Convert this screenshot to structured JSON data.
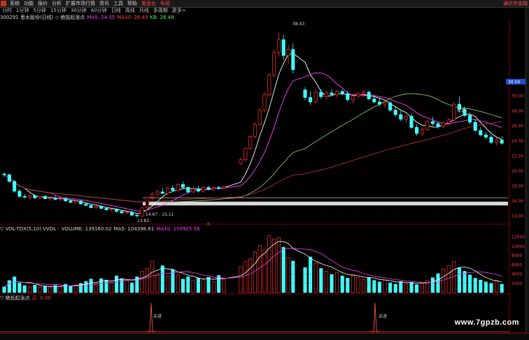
{
  "menu": {
    "items": [
      "系统",
      "功能",
      "报价",
      "分析",
      "扩展市场行情",
      "资讯",
      "工具",
      "帮助",
      "看盘台",
      "布局"
    ],
    "brand": "通达信金融"
  },
  "periods": [
    "分时",
    "1分钟",
    "5分钟",
    "15分钟",
    "30分钟",
    "60分钟",
    "日线",
    "周线",
    "月线",
    "多周期",
    "更多>"
  ],
  "info": {
    "title": "300291 思水股份(日线) ◇ 绝抵起涨点",
    "ma5": "MA5: 24.35",
    "ma30": "MA30: 26.49",
    "k": "KB: 26.48"
  },
  "vol_info": {
    "title": "▽ VOL-TDX(5,10)  VVOL -",
    "volume": "VOLUME: 139160.02",
    "ma5": "MA5: 104398.61",
    "ma10": "MA10: 150925.58"
  },
  "ind_info": {
    "title": "▽ 绝抵起涨点",
    "value": "买: 0.00"
  },
  "price_labels": {
    "high": "38.43",
    "low_a": "13.81",
    "range_a": "14.67 - 15.11",
    "band": "15.16 - 16.15",
    "buy1": "买进",
    "buy2": "买进",
    "buy3": "买进",
    "current": "30.50"
  },
  "y_ticks_price": [
    "30.00",
    "28.00",
    "26.00",
    "24.00",
    "22.00",
    "20.00",
    "18.00",
    "16.00",
    "14.00"
  ],
  "y_ticks_vol": [
    "12000",
    "10000",
    "8000",
    "6000",
    "4000",
    "2000"
  ],
  "x_labels": [
    "2017年",
    "3",
    "4",
    "2017/04/09四",
    "6",
    "7",
    "8",
    "9",
    "10",
    "11"
  ],
  "marker_bottom": "6",
  "watermark": "www.7gpzb.com",
  "colors": {
    "up": "#ff3030",
    "down": "#40ffff",
    "ma5": "#ffffff",
    "ma10": "#ff40ff",
    "ma30": "#80c060",
    "ma60": "#b03030",
    "grid": "#5a0000"
  },
  "chart_data": {
    "type": "candlestick",
    "title": "",
    "ylim": [
      13,
      40
    ],
    "candles": [
      [
        19.6,
        19.8,
        19.2,
        19.5
      ],
      [
        19.5,
        19.6,
        18.4,
        18.6
      ],
      [
        18.6,
        18.8,
        17.1,
        17.3
      ],
      [
        17.3,
        17.6,
        16.4,
        16.6
      ],
      [
        16.6,
        16.9,
        16.3,
        16.5
      ],
      [
        16.5,
        16.8,
        16.2,
        16.7
      ],
      [
        16.7,
        16.9,
        16.3,
        16.4
      ],
      [
        16.4,
        16.7,
        16.2,
        16.6
      ],
      [
        16.6,
        16.8,
        16.2,
        16.3
      ],
      [
        16.3,
        16.6,
        16.0,
        16.4
      ],
      [
        16.4,
        16.7,
        16.1,
        16.2
      ],
      [
        16.2,
        16.5,
        16.0,
        16.3
      ],
      [
        16.3,
        16.5,
        15.9,
        16.0
      ],
      [
        16.0,
        16.2,
        15.7,
        15.8
      ],
      [
        15.8,
        16.1,
        15.6,
        16.0
      ],
      [
        16.0,
        16.1,
        15.5,
        15.6
      ],
      [
        15.6,
        15.8,
        15.3,
        15.4
      ],
      [
        15.4,
        15.6,
        15.0,
        15.1
      ],
      [
        15.1,
        15.4,
        14.9,
        15.3
      ],
      [
        15.3,
        15.5,
        14.9,
        15.0
      ],
      [
        15.0,
        15.2,
        14.7,
        14.8
      ],
      [
        14.8,
        15.0,
        14.6,
        14.9
      ],
      [
        14.9,
        15.0,
        14.5,
        14.6
      ],
      [
        14.6,
        14.8,
        14.3,
        14.4
      ],
      [
        14.4,
        14.6,
        14.2,
        14.5
      ],
      [
        14.5,
        14.7,
        14.0,
        14.1
      ],
      [
        14.1,
        14.3,
        13.8,
        14.0
      ],
      [
        14.0,
        15.2,
        13.9,
        15.1
      ],
      [
        15.1,
        16.6,
        15.0,
        16.5
      ],
      [
        16.5,
        17.2,
        16.1,
        16.9
      ],
      [
        16.9,
        17.5,
        16.6,
        17.2
      ],
      [
        17.2,
        17.7,
        16.9,
        17.0
      ],
      [
        17.0,
        17.9,
        16.8,
        17.7
      ],
      [
        17.7,
        18.1,
        17.2,
        17.4
      ],
      [
        17.4,
        18.4,
        17.3,
        18.2
      ],
      [
        18.2,
        18.6,
        17.6,
        17.8
      ],
      [
        17.8,
        18.0,
        17.0,
        17.2
      ],
      [
        17.2,
        17.8,
        17.0,
        17.6
      ],
      [
        17.6,
        18.0,
        17.1,
        17.3
      ],
      [
        17.3,
        17.9,
        17.1,
        17.8
      ],
      [
        17.8,
        18.0,
        17.4,
        17.6
      ],
      [
        17.6,
        17.9,
        17.3,
        17.8
      ],
      [
        17.8,
        18.0,
        17.5,
        17.7
      ],
      [
        17.7,
        18.0,
        17.5,
        17.9
      ],
      [
        21.0,
        21.8,
        20.8,
        21.5
      ],
      [
        21.5,
        23.1,
        21.3,
        23.0
      ],
      [
        23.0,
        24.8,
        22.8,
        24.6
      ],
      [
        24.6,
        26.5,
        24.3,
        26.2
      ],
      [
        26.2,
        28.4,
        26.0,
        28.1
      ],
      [
        28.1,
        30.5,
        27.8,
        30.2
      ],
      [
        30.2,
        33.0,
        29.9,
        32.8
      ],
      [
        32.8,
        36.2,
        32.5,
        35.8
      ],
      [
        35.8,
        38.43,
        35.2,
        37.5
      ],
      [
        37.5,
        38.2,
        34.8,
        35.4
      ],
      [
        35.4,
        36.8,
        34.2,
        36.2
      ],
      [
        36.2,
        37.0,
        33.0,
        33.5
      ],
      [
        30.8,
        31.2,
        29.4,
        29.8
      ],
      [
        29.8,
        30.6,
        28.8,
        29.2
      ],
      [
        29.2,
        30.8,
        29.0,
        30.5
      ],
      [
        30.5,
        30.9,
        29.6,
        29.9
      ],
      [
        29.9,
        30.7,
        29.5,
        30.4
      ],
      [
        30.4,
        30.9,
        30.0,
        30.2
      ],
      [
        30.2,
        30.8,
        29.8,
        30.6
      ],
      [
        30.6,
        30.9,
        30.1,
        30.3
      ],
      [
        30.3,
        30.7,
        29.2,
        29.5
      ],
      [
        29.5,
        30.2,
        29.0,
        30.0
      ],
      [
        30.0,
        30.6,
        29.7,
        30.3
      ],
      [
        30.3,
        30.8,
        29.9,
        30.5
      ],
      [
        30.5,
        30.7,
        29.4,
        29.6
      ],
      [
        29.6,
        30.1,
        29.0,
        29.2
      ],
      [
        29.2,
        29.7,
        28.6,
        28.9
      ],
      [
        28.9,
        29.4,
        28.4,
        29.1
      ],
      [
        29.1,
        29.3,
        27.9,
        28.1
      ],
      [
        28.1,
        28.5,
        27.2,
        27.5
      ],
      [
        27.5,
        28.0,
        26.6,
        26.9
      ],
      [
        26.9,
        27.5,
        26.4,
        27.3
      ],
      [
        27.3,
        27.6,
        25.6,
        25.8
      ],
      [
        25.8,
        26.2,
        24.7,
        25.0
      ],
      [
        25.0,
        25.8,
        24.6,
        25.5
      ],
      [
        25.5,
        26.8,
        25.3,
        26.6
      ],
      [
        26.6,
        27.2,
        26.0,
        26.3
      ],
      [
        26.3,
        26.6,
        25.6,
        25.9
      ],
      [
        25.9,
        26.6,
        25.7,
        26.4
      ],
      [
        26.4,
        27.0,
        26.1,
        26.8
      ],
      [
        26.8,
        29.2,
        26.6,
        28.9
      ],
      [
        28.9,
        29.9,
        27.8,
        28.2
      ],
      [
        28.2,
        28.6,
        27.2,
        27.4
      ],
      [
        27.4,
        27.8,
        26.2,
        26.5
      ],
      [
        26.5,
        26.9,
        25.2,
        25.4
      ],
      [
        25.4,
        25.8,
        24.6,
        24.8
      ],
      [
        24.8,
        25.2,
        24.2,
        24.5
      ],
      [
        24.5,
        24.8,
        23.6,
        23.8
      ],
      [
        23.8,
        24.4,
        23.4,
        24.1
      ],
      [
        24.1,
        24.6,
        23.5,
        23.7
      ]
    ],
    "volumes": [
      1200,
      2600,
      3400,
      2100,
      1500,
      1300,
      1600,
      1100,
      1400,
      1200,
      1500,
      1300,
      1800,
      1400,
      1600,
      2000,
      2400,
      2900,
      1900,
      3000,
      2700,
      2300,
      3600,
      3000,
      2600,
      2100,
      3400,
      4600,
      5200,
      6800,
      4100,
      5800,
      3600,
      4900,
      3800,
      2900,
      3400,
      2600,
      3100,
      2800,
      3300,
      2400,
      3700,
      2900,
      5600,
      6700,
      7300,
      8800,
      10200,
      9400,
      12300,
      11600,
      11900,
      9800,
      7600,
      6800,
      5400,
      7700,
      6300,
      5200,
      4600,
      3900,
      4300,
      3600,
      3100,
      3900,
      3300,
      2800,
      3200,
      2600,
      2300,
      2700,
      2100,
      1800,
      2400,
      1900,
      2200,
      1700,
      2100,
      2600,
      3200,
      4100,
      5100,
      5800,
      6700,
      5400,
      4600,
      3800,
      3100,
      2700,
      2300,
      2000,
      2600,
      1800
    ],
    "y_ticks": [
      14,
      16,
      18,
      20,
      22,
      24,
      26,
      28,
      30
    ]
  }
}
